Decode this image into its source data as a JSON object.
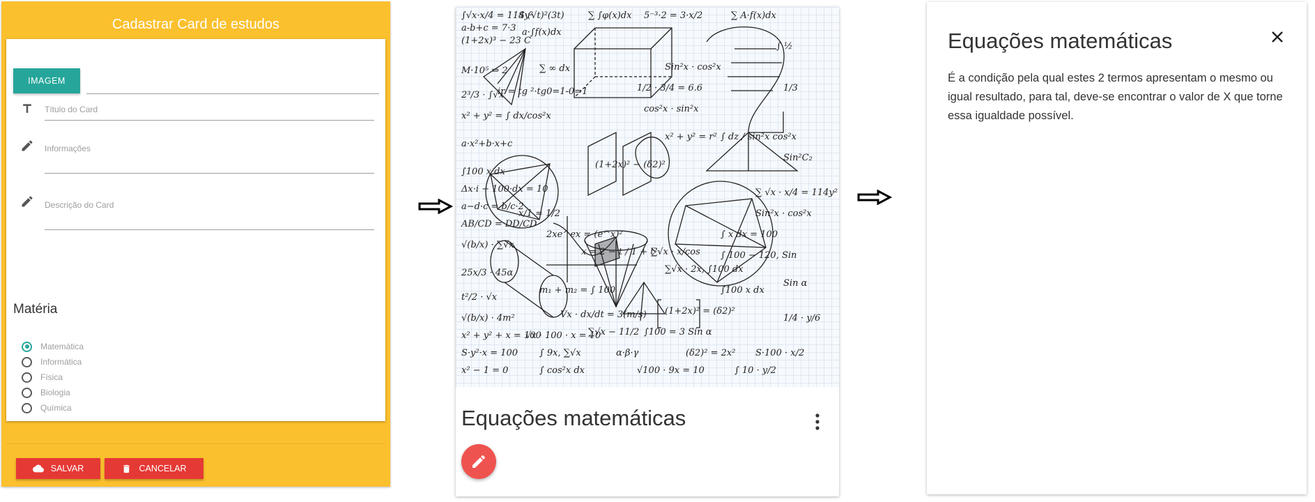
{
  "form": {
    "title": "Cadastrar Card de estudos",
    "image_button": "IMAGEM",
    "title_placeholder": "Título do Card",
    "info_placeholder": "Informações",
    "description_placeholder": "Descrição do Card",
    "subject_heading": "Matéria",
    "subjects": [
      {
        "label": "Matemática",
        "checked": true
      },
      {
        "label": "Informática",
        "checked": false
      },
      {
        "label": "Física",
        "checked": false
      },
      {
        "label": "Biologia",
        "checked": false
      },
      {
        "label": "Química",
        "checked": false
      }
    ],
    "save_label": "SALVAR",
    "cancel_label": "CANCELAR"
  },
  "card": {
    "title": "Equações matemáticas"
  },
  "reveal": {
    "title": "Equações matemáticas",
    "text": "É a condição pela qual estes 2 termos apresentam o mesmo ou igual resultado, para tal, deve-se encontrar o valor de X que torne essa igualdade possível."
  },
  "colors": {
    "panel_yellow": "#fbc02d",
    "teal": "#26a69a",
    "red": "#e53935",
    "fab_red": "#ef5350"
  },
  "icons": {
    "title_field": "text-format-icon",
    "info_field": "pencil-icon",
    "description_field": "pencil-icon",
    "save": "cloud-icon",
    "cancel": "trash-icon",
    "more": "more-vert-icon",
    "edit": "pencil-icon",
    "close": "close-icon"
  }
}
